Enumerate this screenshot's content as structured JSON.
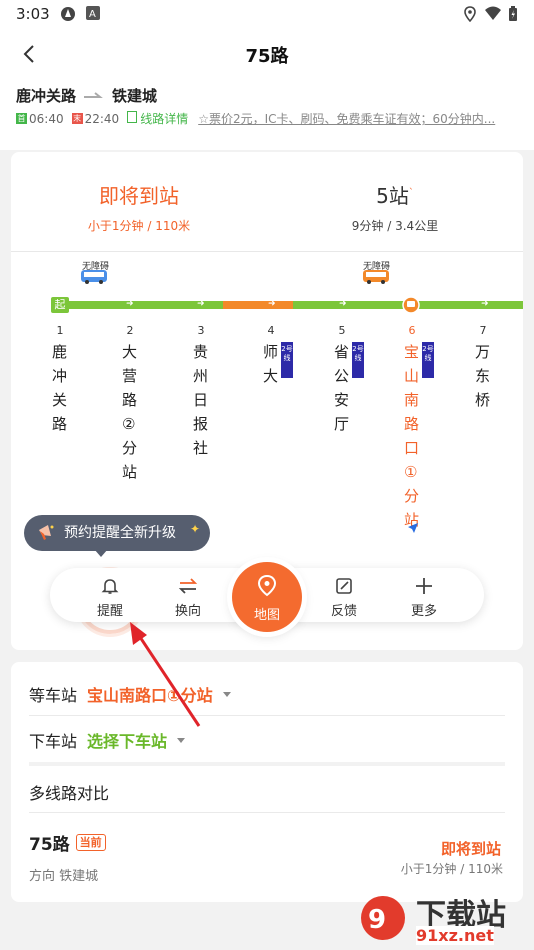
{
  "status_bar": {
    "time": "3:03"
  },
  "header": {
    "title": "75路",
    "route_from": "鹿冲关路",
    "route_to": "铁建城",
    "first_bus": "06:40",
    "first_tag": "首",
    "last_bus": "22:40",
    "last_tag": "末",
    "detail_link": "线路详情",
    "fare_info": "☆票价2元，IC卡、刷码、免费乘车证有效；60分钟内..."
  },
  "arrival": {
    "left_main": "即将到站",
    "left_sub": "小于1分钟 / 110米",
    "right_main": "5站",
    "right_sub": "9分钟 / 3.4公里"
  },
  "barrier_free_label": "无障碍",
  "start_marker": "起",
  "stations": [
    {
      "num": "1",
      "name": "鹿冲关路",
      "badge": ""
    },
    {
      "num": "2",
      "name": "大营路②分站",
      "badge": ""
    },
    {
      "num": "3",
      "name": "贵州日报社",
      "badge": ""
    },
    {
      "num": "4",
      "name": "师大",
      "badge": "2号线"
    },
    {
      "num": "5",
      "name": "省公安厅",
      "badge": "2号线"
    },
    {
      "num": "6",
      "name": "宝山南路口①分站",
      "badge": "2号线"
    },
    {
      "num": "7",
      "name": "万东桥",
      "badge": ""
    }
  ],
  "tooltip": "预约提醒全新升级",
  "toolbar": {
    "remind": "提醒",
    "switch": "换向",
    "map": "地图",
    "feedback": "反馈",
    "more": "更多"
  },
  "bottom": {
    "wait_label": "等车站",
    "wait_value": "宝山南路口①分站",
    "off_label": "下车站",
    "off_value": "选择下车站",
    "compare": "多线路对比",
    "route_name": "75路",
    "current_tag": "当前",
    "direction": "方向 铁建城",
    "arrive_main": "即将到站",
    "arrive_sub": "小于1分钟 / 110米"
  },
  "watermark": {
    "text": "下载站",
    "url_text": "91xz.net"
  },
  "colors": {
    "accent": "#f2622a",
    "green": "#6ab82a",
    "line2": "#2d2aa8",
    "track_green": "#7cc63a",
    "track_orange": "#f3892a",
    "tooltip_bg": "#565e6f"
  }
}
